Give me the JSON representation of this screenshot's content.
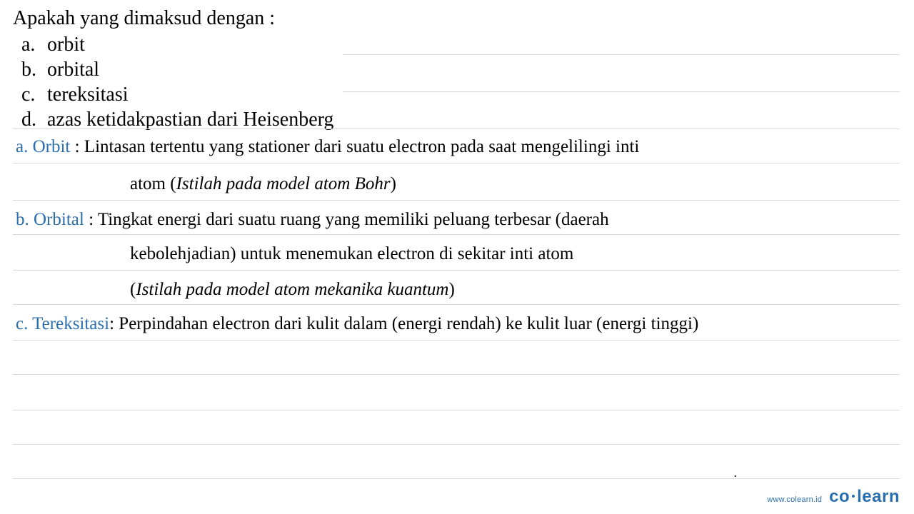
{
  "question": {
    "stem": "Apakah yang dimaksud dengan :",
    "items": [
      {
        "marker": "a.",
        "text": "orbit"
      },
      {
        "marker": "b.",
        "text": "orbital"
      },
      {
        "marker": "c.",
        "text": "tereksitasi"
      },
      {
        "marker": "d.",
        "text": "azas ketidakpastian dari Heisenberg"
      }
    ]
  },
  "answers": {
    "a": {
      "term": "a. Orbit",
      "sep": " : ",
      "line1": "Lintasan tertentu yang stationer dari suatu electron pada saat mengelilingi inti",
      "line2_pre": "atom (",
      "line2_note": "Istilah pada model atom Bohr",
      "line2_post": ")"
    },
    "b": {
      "term": "b. Orbital",
      "sep": " : ",
      "line1": "Tingkat energi dari suatu ruang yang memiliki peluang terbesar (daerah",
      "line2": "kebolehjadian) untuk menemukan electron di sekitar inti atom",
      "line3_pre": "(",
      "line3_note": "Istilah pada model atom mekanika kuantum",
      "line3_post": ")"
    },
    "c": {
      "term": "c. Tereksitasi",
      "sep": ": ",
      "line1": "Perpindahan electron dari kulit dalam (energi rendah) ke kulit luar (energi tinggi)"
    }
  },
  "footer": {
    "url": "www.colearn.id",
    "brand_left": "co",
    "brand_right": "learn"
  },
  "stray_dot": "."
}
